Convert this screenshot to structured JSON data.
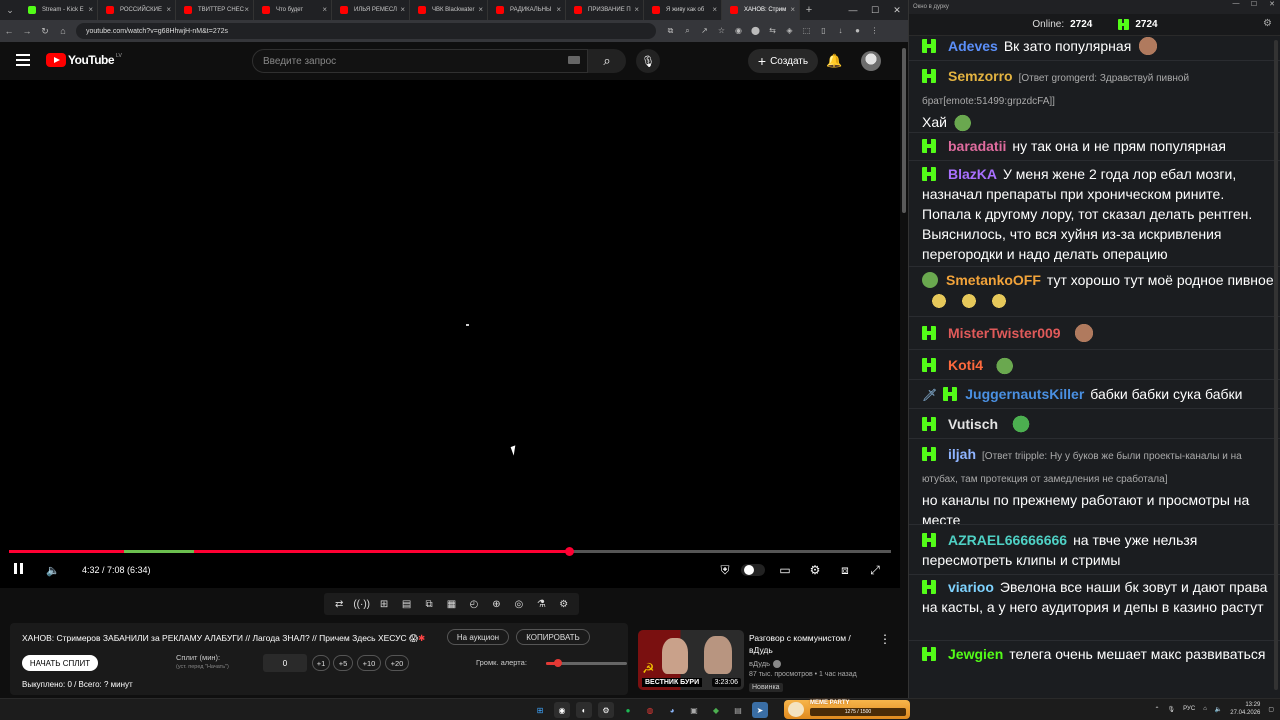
{
  "browser": {
    "tabs": [
      {
        "label": "Stream - Kick E",
        "color": "#53fc18"
      },
      {
        "label": "РОССИЙСКИЕ",
        "color": "#ff0000"
      },
      {
        "label": "ТВИТТЕР СНЕС",
        "color": "#ff0000"
      },
      {
        "label": "Что будет",
        "color": "#ff0000"
      },
      {
        "label": "ИЛЬЯ РЕМЕСЛ",
        "color": "#ff0000"
      },
      {
        "label": "ЧВК Blackwater",
        "color": "#ff0000"
      },
      {
        "label": "РАДИКАЛЬНЫ",
        "color": "#ff0000"
      },
      {
        "label": "ПРИЗВАНИЕ П",
        "color": "#ff0000"
      },
      {
        "label": "Я живу как об",
        "color": "#ff0000"
      },
      {
        "label": "ХАНОВ: Стрим",
        "color": "#ff0000"
      }
    ],
    "url": "youtube.com/watch?v=g68HhwjH-nM&t=272s"
  },
  "youtube": {
    "logo_text": "YouTube",
    "country": "LV",
    "search_placeholder": "Введите запрос",
    "create_label": "Создать"
  },
  "player": {
    "time": "4:32 / 7:08 (6:34)",
    "progress": 0.635,
    "buffered": 0.21,
    "chapter_start": 0.13,
    "chapter_end": 0.21
  },
  "split": {
    "title": "ХАНОВ: Стримеров ЗАБАНИЛИ за РЕКЛАМУ АЛАБУГИ // Лагода ЗНАЛ? // Причем Здесь ХЕСУС",
    "auction_label": "На аукцион",
    "copy_label": "КОПИРОВАТЬ",
    "start_label": "НАЧАТЬ СПЛИТ",
    "split_label": "Сплит (мин):",
    "split_sub": "(уст. перед \"Начать\")",
    "split_value": "0",
    "steps": [
      "+1",
      "+5",
      "+10",
      "+20"
    ],
    "alert_label": "Громк. алерта:",
    "alert_volume": 0.15,
    "status": "Выкуплено: 0 / Всего: ? минут"
  },
  "recommendation": {
    "title": "Разговор с коммунистом / вДудь",
    "channel": "вДудь",
    "meta": "87 тыс. просмотров • 1 час назад",
    "badge": "Новинка",
    "thumb_caption": "ВЕСТНИК БУРИ",
    "duration": "3:23:06"
  },
  "chat": {
    "window_title": "Окно в дурку",
    "online_label": "Online:",
    "online_count": "2724",
    "viewers_count": "2724",
    "messages": [
      {
        "user": "Adeves",
        "color": "#5b8ff9",
        "text": "Вк зато популярная",
        "emote": "em-face"
      },
      {
        "user": "Semzorro",
        "color": "#e3b341",
        "reply": "[Ответ gromgerd: Здравствуй пивной брат[emote:51499:grpzdcFA]]",
        "text": "Хай",
        "emote": "em-frog"
      },
      {
        "user": "baradatii",
        "color": "#e06c9f",
        "text": "ну так она и не прям популярная"
      },
      {
        "user": "BlazKA",
        "color": "#a970ff",
        "text": "У меня жене 2 года лор ебал мозги, назначал препараты при хроническом рините. Попала к другому лору, тот сказал делать рентген. Выяснилось, что вся хуйня из-за искривления перегородки и надо делать операцию"
      },
      {
        "user": "SmetankoOFF",
        "color": "#f2a33a",
        "text": "тут хорошо тут моё родное пивное",
        "emote": "em-beer"
      },
      {
        "user": "MisterTwister009",
        "color": "#e05a5a",
        "text": "",
        "emote": "em-face"
      },
      {
        "user": "Koti4",
        "color": "#ff6a3d",
        "text": "",
        "emote": "em-frog"
      },
      {
        "user": "JuggernautsKiller",
        "color": "#4a90e2",
        "text": "бабки бабки сука бабки"
      },
      {
        "user": "Vutisch",
        "color": "#e3e3e3",
        "text": "",
        "emote": "em-green"
      },
      {
        "user": "iljah",
        "color": "#8fb4ff",
        "reply": "[Ответ triipple: Ну у буков же были проекты-каналы и на ютубах, там протекция от замедления не сработала]",
        "text": "но каналы по прежнему работают и просмотры на месте"
      },
      {
        "user": "AZRAEL66666666",
        "color": "#4fd1c5",
        "text": "на твче уже нельзя пересмотреть клипы и стримы"
      },
      {
        "user": "viarioo",
        "color": "#7fd3ff",
        "text": "Эвелона все наши бк зовут и дают права на касты, а у него аудитория и депы в казино растут"
      },
      {
        "user": "Jewgien",
        "color": "#53fc18",
        "text": "телега очень мешает макс развиваться"
      }
    ]
  },
  "taskbar": {
    "meme_title": "MEME PARTY",
    "meme_progress": "1275 / 1500",
    "lang": "РУС",
    "time": "13:29",
    "date": "27.04.2026"
  }
}
